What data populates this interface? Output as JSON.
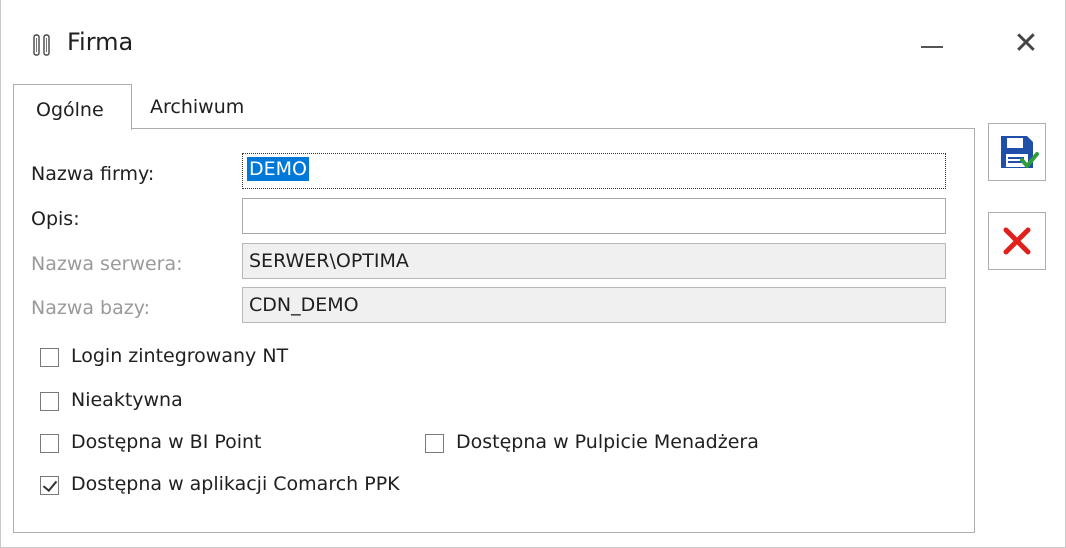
{
  "window": {
    "title": "Firma",
    "minimize_icon": "minimize-icon",
    "close_symbol": "✕"
  },
  "tabs": [
    {
      "label": "Ogólne",
      "active": true
    },
    {
      "label": "Archiwum",
      "active": false
    }
  ],
  "form": {
    "company_name_label": "Nazwa firmy:",
    "company_name_value": "DEMO",
    "description_label": "Opis:",
    "description_value": "",
    "server_label": "Nazwa serwera:",
    "server_value": "SERWER\\OPTIMA",
    "database_label": "Nazwa bazy:",
    "database_value": "CDN_DEMO"
  },
  "checkboxes": {
    "login_nt": {
      "label": "Login zintegrowany NT",
      "checked": false
    },
    "inactive": {
      "label": "Nieaktywna",
      "checked": false
    },
    "bi_point": {
      "label": "Dostępna w BI Point",
      "checked": false
    },
    "manager_desktop": {
      "label": "Dostępna w Pulpicie Menadżera",
      "checked": false
    },
    "comarch_ppk": {
      "label": "Dostępna w aplikacji Comarch PPK",
      "checked": true
    }
  },
  "toolbar": {
    "save_icon": "save-disk-check-icon",
    "cancel_icon": "cancel-red-x-icon"
  },
  "colors": {
    "selection": "#0078d7",
    "save_blue": "#1f4fa8",
    "check_green": "#2e9e3a",
    "cancel_red": "#e0201b"
  }
}
